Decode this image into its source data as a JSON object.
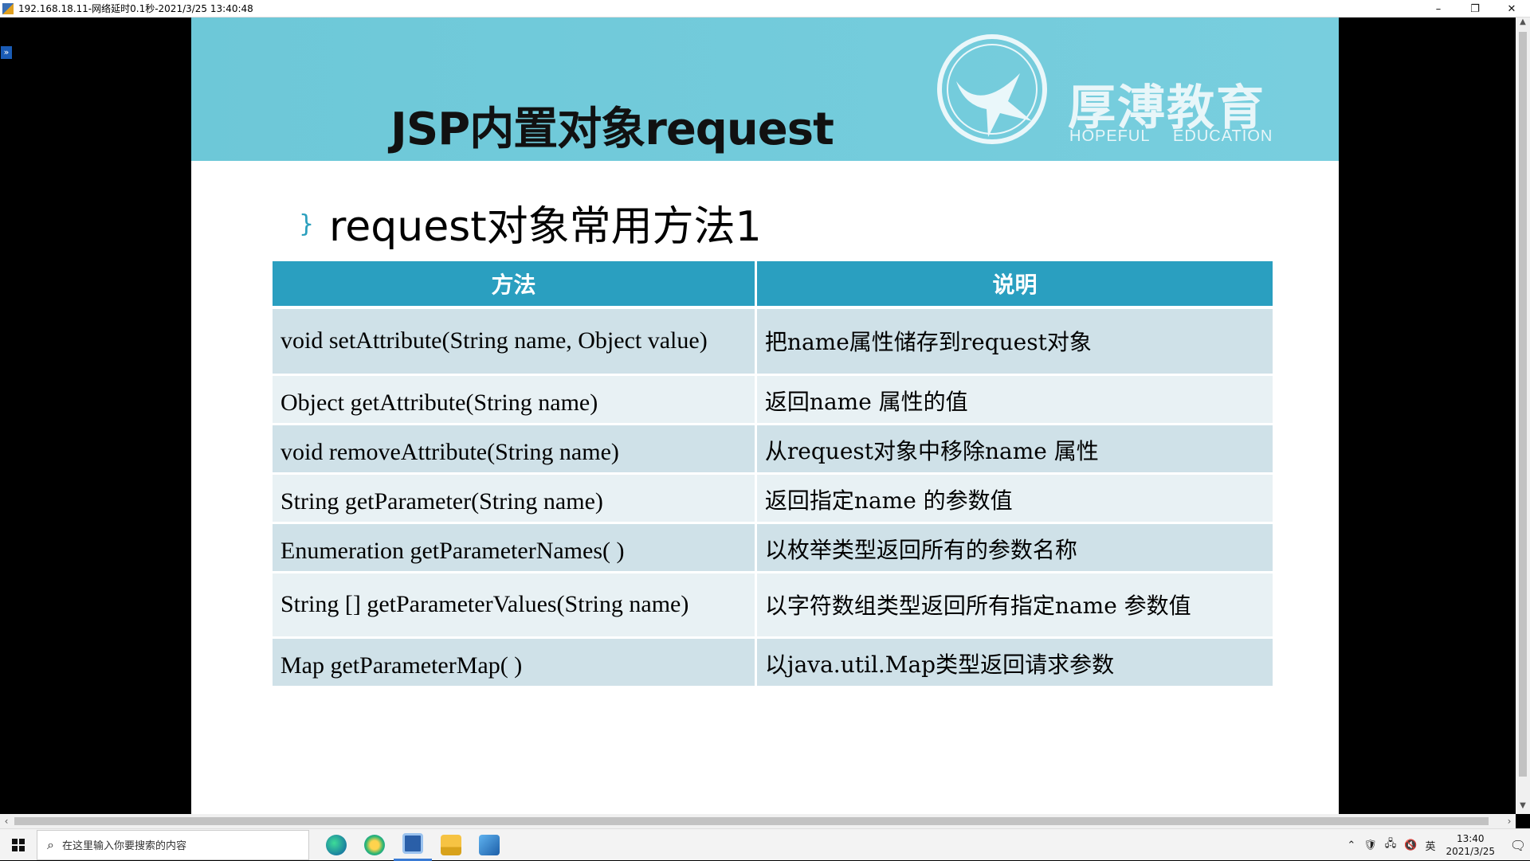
{
  "window": {
    "title": "192.168.18.11-网络延时0.1秒-2021/3/25 13:40:48",
    "minimize": "–",
    "restore": "❐",
    "close": "✕"
  },
  "expander_glyph": "»",
  "slide": {
    "title": "JSP内置对象request",
    "logo": {
      "brand": "厚溥教育",
      "tag_left": "HOPEFUL",
      "tag_right": "EDUCATION"
    },
    "bullet": "}",
    "heading": "request对象常用方法1",
    "table": {
      "headers": [
        "方法",
        "说明"
      ],
      "rows": [
        {
          "method": "void setAttribute(String name, Object value)",
          "desc": "把name属性储存到request对象"
        },
        {
          "method": "Object getAttribute(String name)",
          "desc": "返回name 属性的值"
        },
        {
          "method": "void removeAttribute(String name)",
          "desc": "从request对象中移除name 属性"
        },
        {
          "method": "String getParameter(String name)",
          "desc": "返回指定name 的参数值"
        },
        {
          "method": "Enumeration getParameterNames( )",
          "desc": "以枚举类型返回所有的参数名称"
        },
        {
          "method": "String [] getParameterValues(String name)",
          "desc": "以字符数组类型返回所有指定name 参数值"
        },
        {
          "method": "Map getParameterMap( )",
          "desc": "以java.util.Map类型返回请求参数"
        }
      ]
    }
  },
  "taskbar": {
    "search_placeholder": "在这里输入你要搜索的内容",
    "apps": [
      "edge-icon",
      "browser-icon",
      "remote-desktop-icon",
      "file-explorer-icon",
      "photos-icon"
    ],
    "ime": "英",
    "time": "13:40",
    "date": "2021/3/25"
  },
  "colors": {
    "banner": "#72cbdb",
    "table_header": "#2a9fc0",
    "row_odd": "#cfe1e8",
    "row_even": "#e8f1f4"
  }
}
